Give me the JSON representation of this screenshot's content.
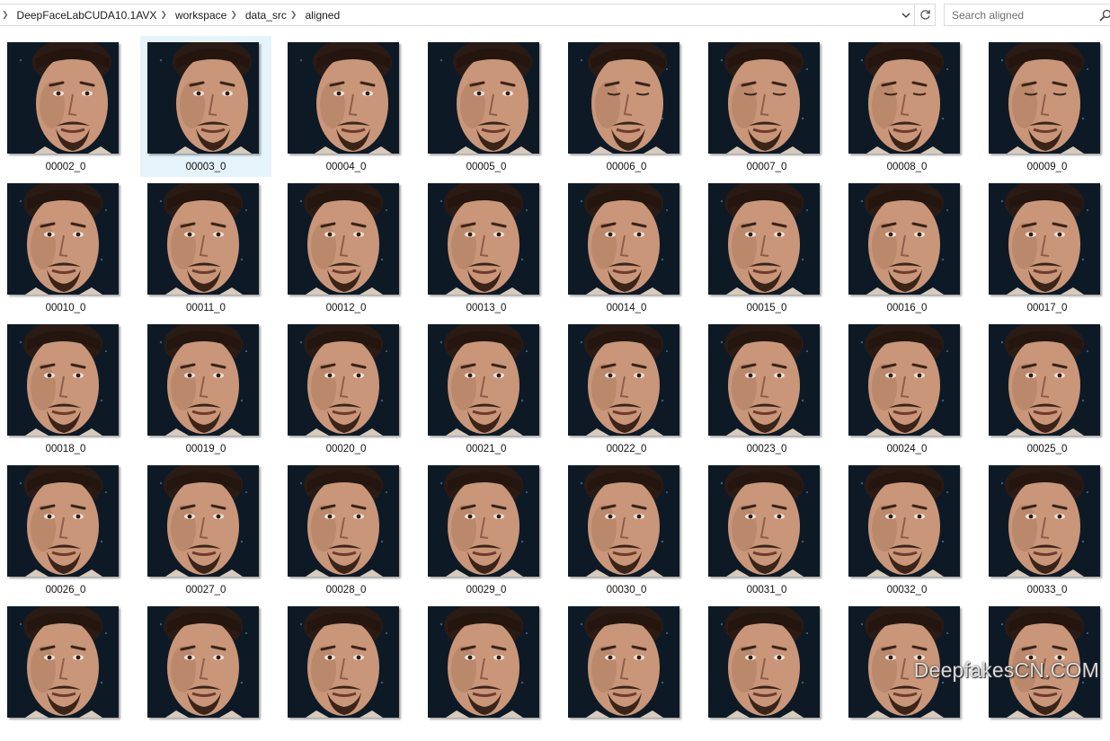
{
  "address_bar": {
    "breadcrumb": [
      "DeepFaceLabCUDA10.1AVX",
      "workspace",
      "data_src",
      "aligned"
    ]
  },
  "search": {
    "placeholder": "Search aligned"
  },
  "files": [
    {
      "name": "00002_0",
      "pose": "left"
    },
    {
      "name": "00003_0",
      "pose": "left",
      "selected": true
    },
    {
      "name": "00004_0",
      "pose": "left"
    },
    {
      "name": "00005_0",
      "pose": "left"
    },
    {
      "name": "00006_0",
      "pose": "down"
    },
    {
      "name": "00007_0",
      "pose": "center"
    },
    {
      "name": "00008_0",
      "pose": "center"
    },
    {
      "name": "00009_0",
      "pose": "center"
    },
    {
      "name": "00010_0",
      "pose": "front"
    },
    {
      "name": "00011_0",
      "pose": "front"
    },
    {
      "name": "00012_0",
      "pose": "front"
    },
    {
      "name": "00013_0",
      "pose": "front"
    },
    {
      "name": "00014_0",
      "pose": "front"
    },
    {
      "name": "00015_0",
      "pose": "front"
    },
    {
      "name": "00016_0",
      "pose": "front"
    },
    {
      "name": "00017_0",
      "pose": "front"
    },
    {
      "name": "00018_0",
      "pose": "front"
    },
    {
      "name": "00019_0",
      "pose": "front"
    },
    {
      "name": "00020_0",
      "pose": "front"
    },
    {
      "name": "00021_0",
      "pose": "front"
    },
    {
      "name": "00022_0",
      "pose": "front"
    },
    {
      "name": "00023_0",
      "pose": "front"
    },
    {
      "name": "00024_0",
      "pose": "front"
    },
    {
      "name": "00025_0",
      "pose": "front"
    },
    {
      "name": "00026_0",
      "pose": "front"
    },
    {
      "name": "00027_0",
      "pose": "front"
    },
    {
      "name": "00028_0",
      "pose": "front"
    },
    {
      "name": "00029_0",
      "pose": "front"
    },
    {
      "name": "00030_0",
      "pose": "front"
    },
    {
      "name": "00031_0",
      "pose": "front"
    },
    {
      "name": "00032_0",
      "pose": "front"
    },
    {
      "name": "00033_0",
      "pose": "front"
    },
    {
      "name": "",
      "pose": "front"
    },
    {
      "name": "",
      "pose": "front"
    },
    {
      "name": "",
      "pose": "front"
    },
    {
      "name": "",
      "pose": "front"
    },
    {
      "name": "",
      "pose": "front"
    },
    {
      "name": "",
      "pose": "front"
    },
    {
      "name": "",
      "pose": "front"
    },
    {
      "name": "",
      "pose": "front"
    }
  ],
  "watermark": "DeepfakesCN.COM",
  "colors": {
    "selection": "#e5f3fb",
    "thumb_background": "#0d1a26",
    "skin": "#c99679"
  }
}
